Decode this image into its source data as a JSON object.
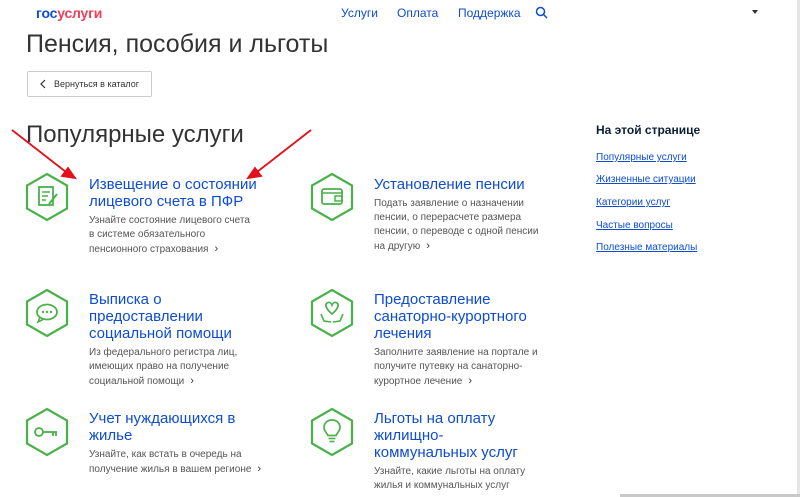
{
  "header": {
    "logo_part1": "гос",
    "logo_part2": "услуги",
    "nav": [
      "Услуги",
      "Оплата",
      "Поддержка"
    ]
  },
  "page_title": "Пенсия, пособия и льготы",
  "back_button_label": "Вернуться в каталог",
  "section_title": "Популярные услуги",
  "services": [
    {
      "title_lines": [
        "Извещение о состоянии",
        "лицевого счета в ПФР"
      ],
      "desc_lines": [
        "Узнайте состояние лицевого счета",
        "в системе обязательного",
        "пенсионного страхования"
      ],
      "icon": "document-edit-icon"
    },
    {
      "title_lines": [
        "Установление пенсии"
      ],
      "desc_lines": [
        "Подать заявление о назначении",
        "пенсии, о перерасчете размера",
        "пенсии, о переводе с одной пенсии",
        "на другую"
      ],
      "icon": "wallet-icon"
    },
    {
      "title_lines": [
        "Выписка о",
        "предоставлении",
        "социальной помощи"
      ],
      "desc_lines": [
        "Из федерального регистра лиц,",
        "имеющих право на получение",
        "социальной помощи"
      ],
      "icon": "chat-bubble-icon"
    },
    {
      "title_lines": [
        "Предоставление",
        "санаторно-курортного",
        "лечения"
      ],
      "desc_lines": [
        "Заполните заявление на портале и",
        "получите путевку на санаторно-",
        "курортное лечение"
      ],
      "icon": "heart-hands-icon"
    },
    {
      "title_lines": [
        "Учет нуждающихся в",
        "жилье"
      ],
      "desc_lines": [
        "Узнайте, как встать в очередь на",
        "получение жилья в вашем регионе"
      ],
      "icon": "key-icon"
    },
    {
      "title_lines": [
        "Льготы на оплату",
        "жилищно-",
        "коммунальных услуг"
      ],
      "desc_lines": [
        "Узнайте, какие льготы на оплату",
        "жилья и коммунальных услуг"
      ],
      "icon": "lightbulb-icon"
    }
  ],
  "more_glyph": "›",
  "toc": {
    "heading": "На этой странице",
    "links": [
      "Популярные услуги",
      "Жизненные ситуации",
      "Категории услуг",
      "Частые вопросы",
      "Полезные материалы"
    ]
  },
  "colors": {
    "link_blue": "#0d4cd3",
    "icon_green": "#4ab14a",
    "logo_red": "#ee3f58",
    "arrow_red": "#e3101c"
  }
}
